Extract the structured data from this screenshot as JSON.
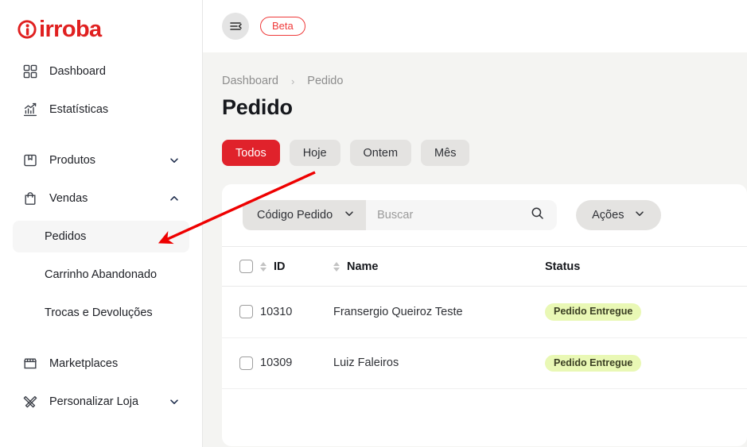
{
  "brand": {
    "name": "irroba",
    "color": "#e02020",
    "logo_icon": "irroba-circle-i-icon"
  },
  "sidebar": {
    "items": [
      {
        "label": "Dashboard",
        "icon": "grid-dashboard-icon",
        "type": "link"
      },
      {
        "label": "Estatísticas",
        "icon": "bar-chart-trend-icon",
        "type": "link"
      },
      {
        "label": "Produtos",
        "icon": "box-package-icon",
        "type": "group",
        "expanded": false,
        "chevron": "chevron-down-icon"
      },
      {
        "label": "Vendas",
        "icon": "shopping-bag-icon",
        "type": "group",
        "expanded": true,
        "chevron": "chevron-up-icon"
      },
      {
        "label": "Marketplaces",
        "icon": "storefront-icon",
        "type": "link"
      },
      {
        "label": "Personalizar Loja",
        "icon": "brush-pencil-icon",
        "type": "group",
        "expanded": false,
        "chevron": "chevron-down-icon"
      }
    ],
    "vendas_children": [
      {
        "label": "Pedidos",
        "active": true
      },
      {
        "label": "Carrinho Abandonado",
        "active": false
      },
      {
        "label": "Trocas e Devoluções",
        "active": false
      }
    ]
  },
  "topbar": {
    "menu_toggle_icon": "menu-collapse-icon",
    "beta_label": "Beta",
    "beta_color": "#ef3b3b"
  },
  "breadcrumb": {
    "root": "Dashboard",
    "separator": "›",
    "current": "Pedido"
  },
  "page": {
    "title": "Pedido"
  },
  "filters": {
    "tabs": [
      {
        "label": "Todos",
        "active": true
      },
      {
        "label": "Hoje",
        "active": false
      },
      {
        "label": "Ontem",
        "active": false
      },
      {
        "label": "Mês",
        "active": false
      }
    ],
    "active_color": "#e0222b"
  },
  "toolbar": {
    "search_field_select": "Código Pedido",
    "search_field_chevron": "chevron-down-icon",
    "search_placeholder": "Buscar",
    "search_value": "",
    "search_icon": "search-icon",
    "actions_label": "Ações",
    "actions_chevron": "chevron-down-icon"
  },
  "table": {
    "select_all_checked": false,
    "columns": [
      {
        "key": "checkbox",
        "label": "",
        "sortable": false
      },
      {
        "key": "id",
        "label": "ID",
        "sortable": true
      },
      {
        "key": "name",
        "label": "Name",
        "sortable": true
      },
      {
        "key": "status",
        "label": "Status",
        "sortable": false
      }
    ],
    "rows": [
      {
        "id": "10310",
        "name": "Fransergio Queiroz Teste",
        "status": "Pedido Entregue",
        "status_bg": "#e9f8b5",
        "checked": false
      },
      {
        "id": "10309",
        "name": "Luiz Faleiros",
        "status": "Pedido Entregue",
        "status_bg": "#e9f8b5",
        "checked": false
      }
    ]
  },
  "annotation": {
    "type": "arrow",
    "color": "#ee0000",
    "points": "from-top-right-to-pedidos-menu-item"
  }
}
